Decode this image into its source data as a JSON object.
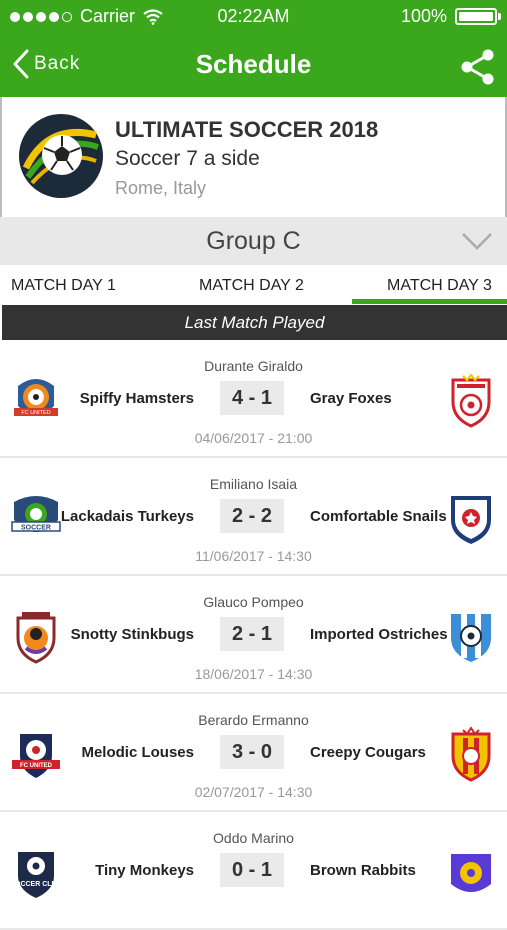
{
  "status": {
    "carrier": "Carrier",
    "time": "02:22AM",
    "battery": "100%",
    "battery_level": 1.0
  },
  "nav": {
    "back_label": "Back",
    "title": "Schedule"
  },
  "tournament": {
    "name": "ULTIMATE SOCCER 2018",
    "type": "Soccer 7 a side",
    "location": "Rome, Italy"
  },
  "group": {
    "label": "Group C"
  },
  "tabs": [
    {
      "label": "MATCH DAY 1"
    },
    {
      "label": "MATCH DAY 2"
    },
    {
      "label": "MATCH DAY 3",
      "active": true
    }
  ],
  "section_label": "Last Match Played",
  "colors": {
    "accent": "#3aa71c",
    "dark_bar": "#333333",
    "group_bg": "#e8e8e8"
  },
  "matches": [
    {
      "referee": "Durante Giraldo",
      "home": "Spiffy Hamsters",
      "score": "4 - 1",
      "away": "Gray Foxes",
      "datetime": "04/06/2017 - 21:00",
      "home_crest_text": "FC UNITED"
    },
    {
      "referee": "Emiliano Isaia",
      "home": "Lackadais Turkeys",
      "score": "2 - 2",
      "away": "Comfortable Snails",
      "datetime": "11/06/2017 - 14:30",
      "home_crest_text": "SOCCER"
    },
    {
      "referee": "Glauco Pompeo",
      "home": "Snotty Stinkbugs",
      "score": "2 - 1",
      "away": "Imported Ostriches",
      "datetime": "18/06/2017 - 14:30"
    },
    {
      "referee": "Berardo Ermanno",
      "home": "Melodic Louses",
      "score": "3 - 0",
      "away": "Creepy Cougars",
      "datetime": "02/07/2017 - 14:30",
      "home_crest_text": "FC UNITED"
    },
    {
      "referee": "Oddo Marino",
      "home": "Tiny Monkeys",
      "score": "0 - 1",
      "away": "Brown Rabbits",
      "datetime": "",
      "home_crest_text": "SOCCER CLUB"
    }
  ]
}
